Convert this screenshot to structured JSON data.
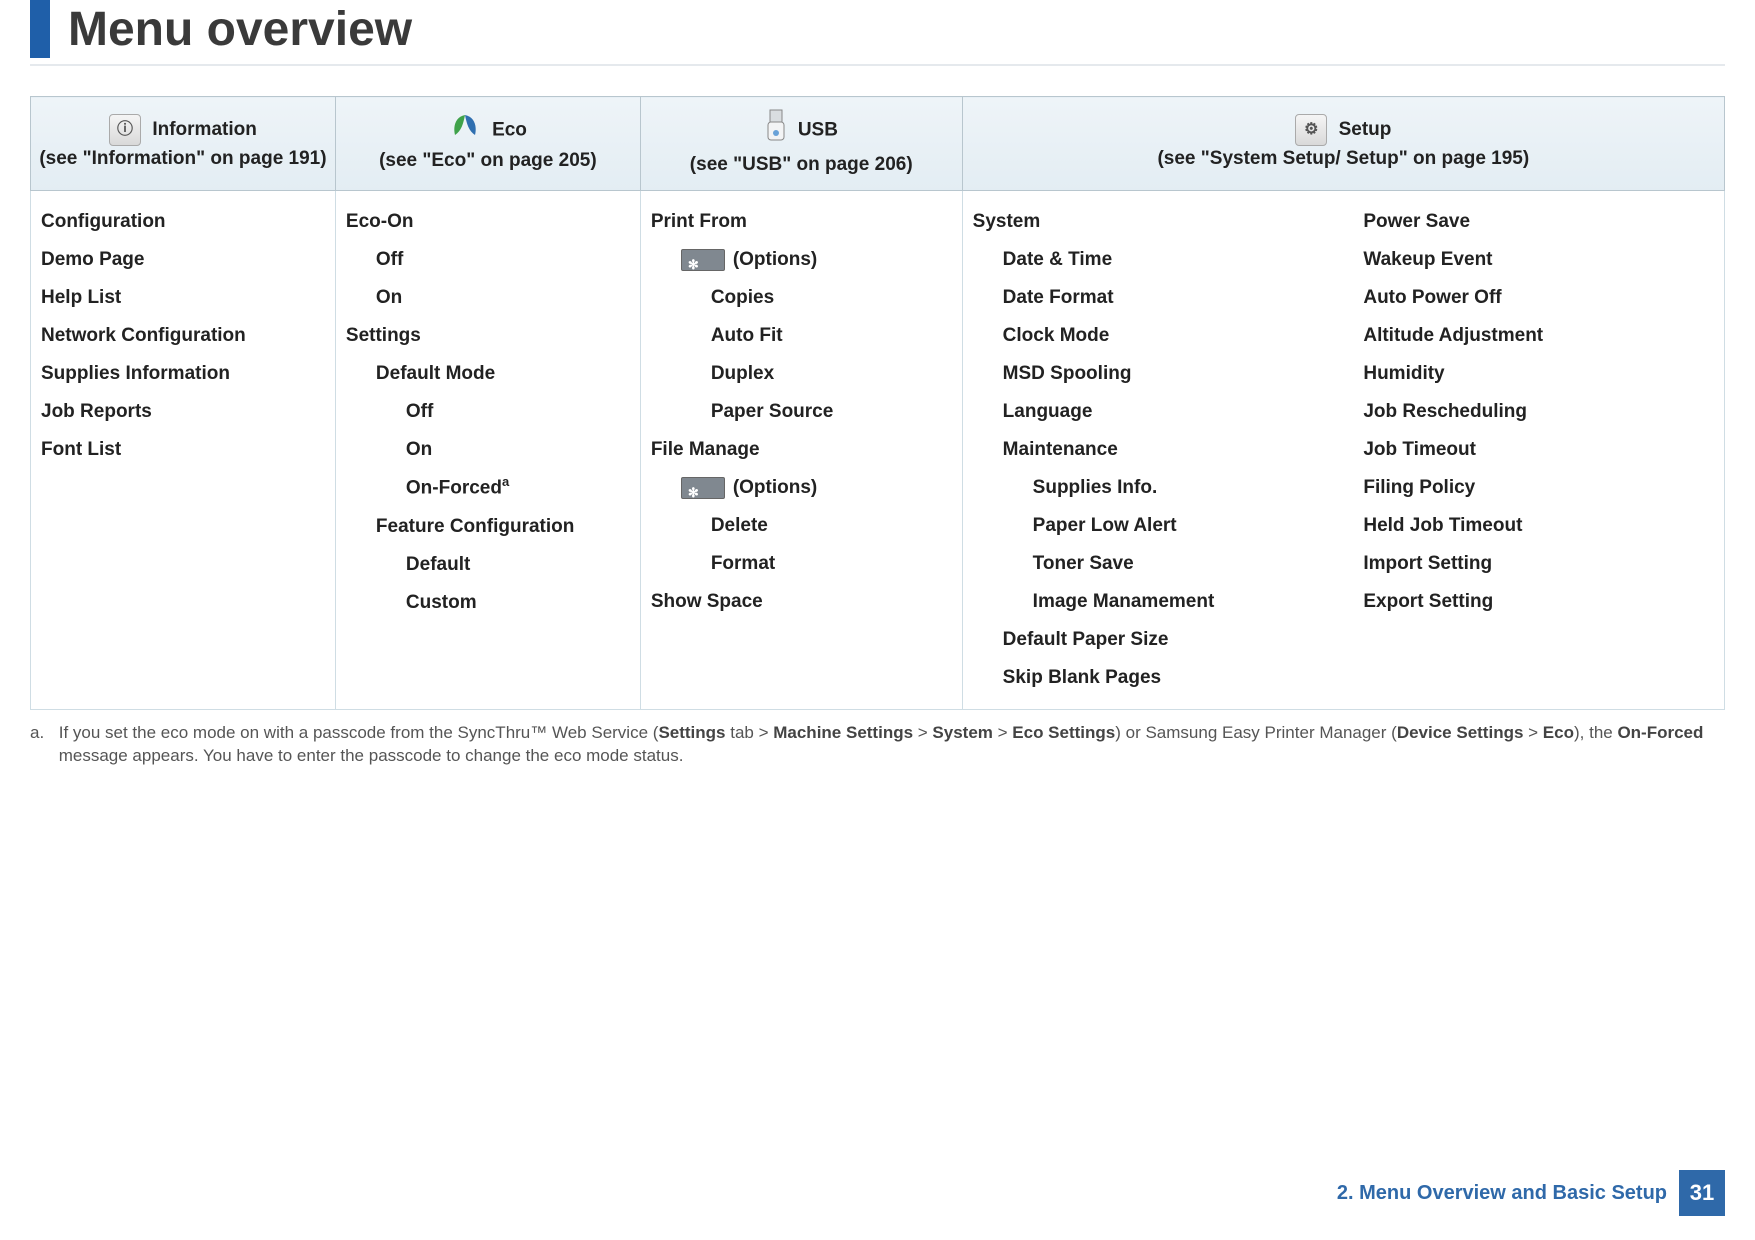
{
  "page": {
    "title": "Menu overview",
    "chapter_label": "2. Menu Overview and Basic Setup",
    "page_number": "31"
  },
  "columns": {
    "information": {
      "head_title": "Information",
      "head_sub": "(see \"Information\" on page 191)",
      "items": [
        "Configuration",
        "Demo Page",
        "Help List",
        "Network Configuration",
        "Supplies Information",
        "Job Reports",
        "Font List"
      ]
    },
    "eco": {
      "head_title": "Eco",
      "head_sub": "(see \"Eco\" on page 205)",
      "eco_on": "Eco-On",
      "eco_on_opts": [
        "Off",
        "On"
      ],
      "settings": "Settings",
      "default_mode": "Default Mode",
      "default_mode_opts_off": "Off",
      "default_mode_opts_on": "On",
      "default_mode_opts_forced": "On-Forced",
      "forced_sup": "a",
      "feature_conf": "Feature Configuration",
      "feature_conf_opts": [
        "Default",
        "Custom"
      ]
    },
    "usb": {
      "head_title": "USB",
      "head_sub": "(see \"USB\" on page 206)",
      "print_from": "Print From",
      "options_label": "(Options)",
      "print_opts": [
        "Copies",
        "Auto Fit",
        "Duplex",
        "Paper Source"
      ],
      "file_manage": "File Manage",
      "file_opts": [
        "Delete",
        "Format"
      ],
      "show_space": "Show Space"
    },
    "setup": {
      "head_title": "Setup",
      "head_sub": "(see \"System Setup/ Setup\" on page 195)",
      "system": "System",
      "system_items": [
        "Date & Time",
        "Date Format",
        "Clock Mode",
        "MSD Spooling",
        "Language"
      ],
      "maintenance": "Maintenance",
      "maintenance_items": [
        "Supplies Info.",
        "Paper Low Alert",
        "Toner Save",
        "Image Manamement"
      ],
      "system_tail": [
        "Default Paper Size",
        "Skip Blank Pages"
      ],
      "right_items": [
        "Power Save",
        "Wakeup Event",
        "Auto Power Off",
        "Altitude Adjustment",
        "Humidity",
        "Job Rescheduling",
        "Job Timeout",
        "Filing Policy",
        "Held Job Timeout",
        "Import Setting",
        "Export Setting"
      ]
    }
  },
  "footnote": {
    "marker": "a.",
    "pre": "If you set the eco mode on with a passcode from the SyncThru™ Web Service (",
    "b1": "Settings",
    "g1": " tab > ",
    "b2": "Machine Settings",
    "g2": " > ",
    "b3": "System",
    "g3": " > ",
    "b4": "Eco Settings",
    "mid": ") or Samsung Easy Printer Manager (",
    "b5": "Device Settings",
    "g4": " > ",
    "b6": "Eco",
    "post1": "), the ",
    "b7": "On-Forced",
    "post2": " message appears. You have to enter the passcode to change the eco mode status."
  }
}
